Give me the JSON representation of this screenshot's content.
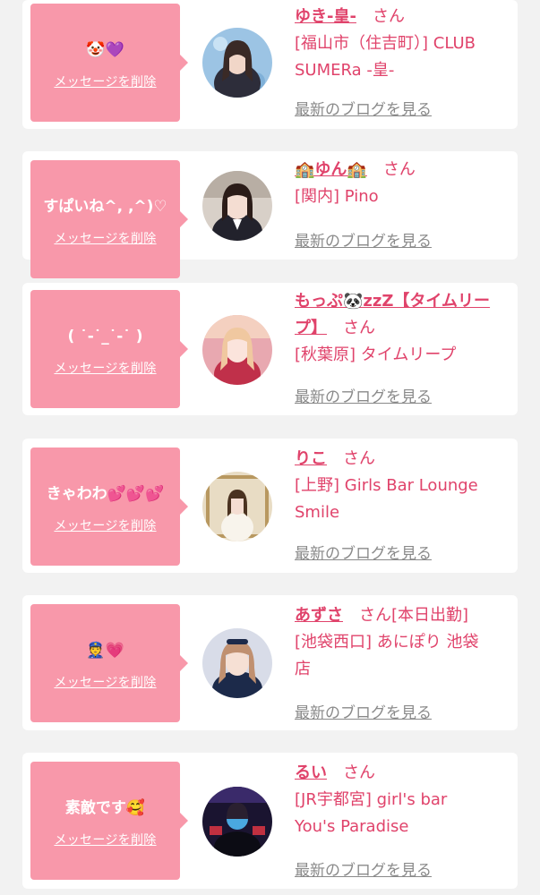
{
  "messages": [
    {
      "message": "🤡💜",
      "delete_label": "メッセージを削除",
      "name": "ゆき-皇-",
      "honorific": "さん",
      "shop_line1": "[福山市（住吉町）] CLUB",
      "shop_line2": "SUMERa -皇-",
      "blog_label": "最新のブログを見る"
    },
    {
      "message": "すぱいね^, ,^)♡",
      "delete_label": "メッセージを削除",
      "name": "🏫ゆん🏫",
      "honorific": "さん",
      "shop_line1": "[関内] Pino",
      "shop_line2": "",
      "blog_label": "最新のブログを見る"
    },
    {
      "message": "( ˙-˙_˙-˙ )",
      "delete_label": "メッセージを削除",
      "name_line1": "もっぷ🐼zzZ【タイムリー",
      "name_line2": "プ】",
      "honorific": "さん",
      "shop_line1": "[秋葉原] タイムリープ",
      "shop_line2": "",
      "blog_label": "最新のブログを見る"
    },
    {
      "message": "きゃわわ💕💕💕",
      "delete_label": "メッセージを削除",
      "name": "りこ",
      "honorific": "さん",
      "shop_line1": "[上野] Girls Bar Lounge",
      "shop_line2": "Smile",
      "blog_label": "最新のブログを見る"
    },
    {
      "message": "👮💗",
      "delete_label": "メッセージを削除",
      "name": "あずさ",
      "honorific": "さん[本日出勤]",
      "shop_line1": "[池袋西口] あにぽり 池袋",
      "shop_line2": "店",
      "blog_label": "最新のブログを見る"
    },
    {
      "message": "素敵です🥰",
      "delete_label": "メッセージを削除",
      "name": "るい",
      "honorific": "さん",
      "shop_line1": "[JR宇都宮] girl's bar",
      "shop_line2": "You's Paradise",
      "blog_label": "最新のブログを見る"
    }
  ]
}
